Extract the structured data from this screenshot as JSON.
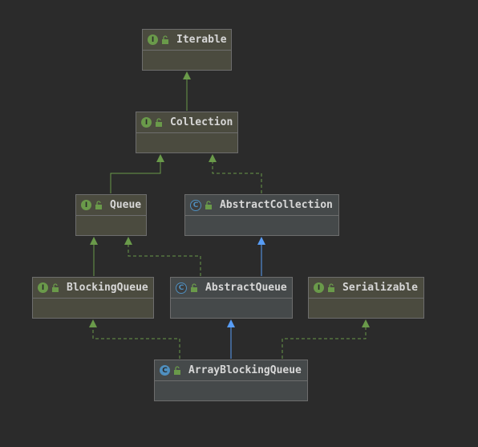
{
  "nodes": {
    "iterable": {
      "label": "Iterable",
      "badge": "I",
      "kind": "interface"
    },
    "collection": {
      "label": "Collection",
      "badge": "I",
      "kind": "interface"
    },
    "queue": {
      "label": "Queue",
      "badge": "I",
      "kind": "interface"
    },
    "abstract_collection": {
      "label": "AbstractCollection",
      "badge": "C",
      "kind": "abstract-class"
    },
    "blocking_queue": {
      "label": "BlockingQueue",
      "badge": "I",
      "kind": "interface"
    },
    "abstract_queue": {
      "label": "AbstractQueue",
      "badge": "C",
      "kind": "abstract-class"
    },
    "serializable": {
      "label": "Serializable",
      "badge": "I",
      "kind": "interface"
    },
    "array_blocking_queue": {
      "label": "ArrayBlockingQueue",
      "badge": "C",
      "kind": "class"
    }
  },
  "colors": {
    "background": "#2b2b2b",
    "interface_fill": "#4b4b3f",
    "class_fill": "#45494a",
    "extends_green": "#6a9a4a",
    "extends_blue": "#589df6",
    "implements_dashed": "#6a9a4a"
  },
  "edges": [
    {
      "from": "collection",
      "to": "iterable",
      "type": "extends"
    },
    {
      "from": "queue",
      "to": "collection",
      "type": "extends"
    },
    {
      "from": "abstract_collection",
      "to": "collection",
      "type": "implements"
    },
    {
      "from": "blocking_queue",
      "to": "queue",
      "type": "extends"
    },
    {
      "from": "abstract_queue",
      "to": "queue",
      "type": "implements"
    },
    {
      "from": "abstract_queue",
      "to": "abstract_collection",
      "type": "extends-class"
    },
    {
      "from": "array_blocking_queue",
      "to": "blocking_queue",
      "type": "implements"
    },
    {
      "from": "array_blocking_queue",
      "to": "abstract_queue",
      "type": "extends-class"
    },
    {
      "from": "array_blocking_queue",
      "to": "serializable",
      "type": "implements"
    }
  ]
}
